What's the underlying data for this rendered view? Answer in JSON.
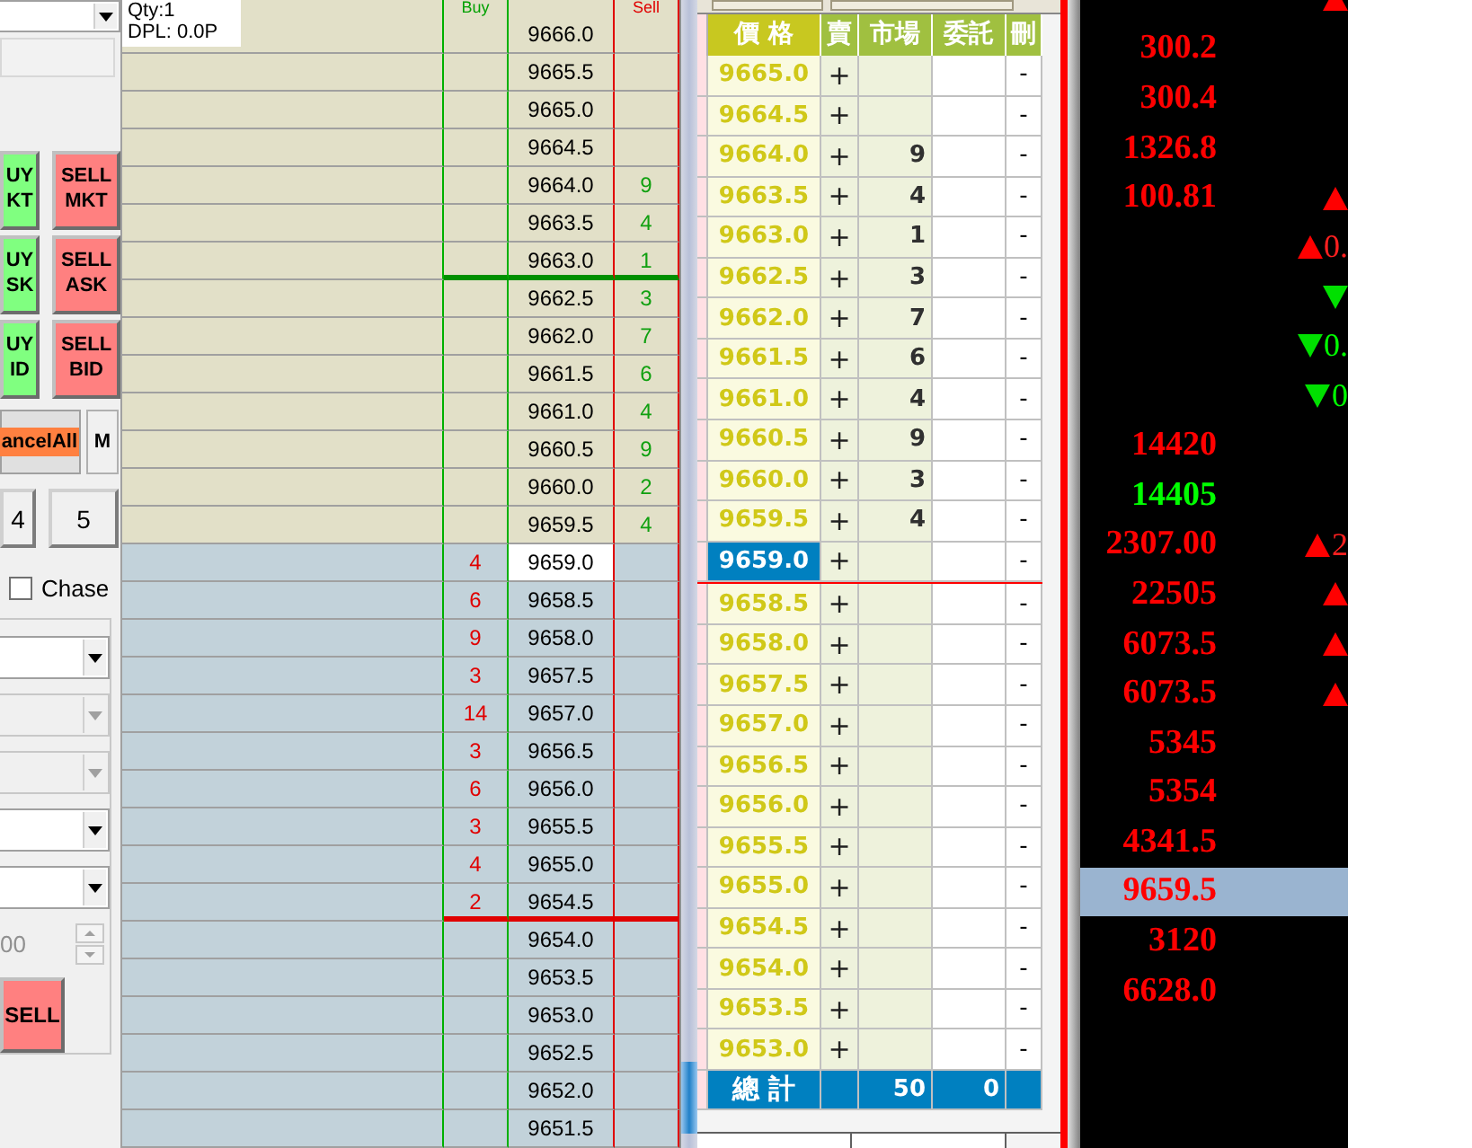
{
  "order_panel": {
    "trade_buttons": [
      {
        "label": "UY\nKT",
        "kind": "buy"
      },
      {
        "label": "SELL\nMKT",
        "kind": "sell"
      },
      {
        "label": "UY\nSK",
        "kind": "buy"
      },
      {
        "label": "SELL\nASK",
        "kind": "sell"
      },
      {
        "label": "UY\nID",
        "kind": "buy"
      },
      {
        "label": "SELL\nBID",
        "kind": "sell"
      }
    ],
    "cancel_all_button": "ancelAll",
    "m_button": "M",
    "number_buttons": [
      "4",
      "5"
    ],
    "chase": {
      "label": "Chase",
      "checked": false
    },
    "dropdowns": [
      {
        "disabled": false
      },
      {
        "disabled": true
      },
      {
        "disabled": true
      },
      {
        "disabled": false
      },
      {
        "disabled": false
      }
    ],
    "spinner": {
      "value": "00",
      "disabled": true
    },
    "sell_button": "SELL"
  },
  "info": {
    "qty": "Qty:1",
    "dpl": "DPL: 0.0P"
  },
  "ladder": {
    "columns": {
      "buy": "Buy",
      "sell": "Sell"
    },
    "rows": [
      {
        "price": "9666.0",
        "kind": "ask",
        "selected": false,
        "line_below": false
      },
      {
        "price": "9665.5",
        "kind": "ask",
        "selected": false,
        "line_below": false
      },
      {
        "price": "9665.0",
        "kind": "ask",
        "selected": false,
        "line_below": false
      },
      {
        "price": "9664.5",
        "kind": "ask",
        "selected": false,
        "line_below": false
      },
      {
        "price": "9664.0",
        "ask": "9",
        "kind": "ask",
        "selected": false,
        "line_below": false
      },
      {
        "price": "9663.5",
        "ask": "4",
        "kind": "ask",
        "selected": false,
        "line_below": false
      },
      {
        "price": "9663.0",
        "ask": "1",
        "kind": "ask",
        "selected": false,
        "line_below": true
      },
      {
        "price": "9662.5",
        "ask": "3",
        "kind": "ask",
        "selected": false,
        "line_below": false
      },
      {
        "price": "9662.0",
        "ask": "7",
        "kind": "ask",
        "selected": false,
        "line_below": false
      },
      {
        "price": "9661.5",
        "ask": "6",
        "kind": "ask",
        "selected": false,
        "line_below": false
      },
      {
        "price": "9661.0",
        "ask": "4",
        "kind": "ask",
        "selected": false,
        "line_below": false
      },
      {
        "price": "9660.5",
        "ask": "9",
        "kind": "ask",
        "selected": false,
        "line_below": false
      },
      {
        "price": "9660.0",
        "ask": "2",
        "kind": "ask",
        "selected": false,
        "line_below": false
      },
      {
        "price": "9659.5",
        "ask": "4",
        "kind": "ask",
        "selected": false,
        "line_below": false
      },
      {
        "price": "9659.0",
        "bid": "4",
        "kind": "bid",
        "selected": true,
        "line_below": false
      },
      {
        "price": "9658.5",
        "bid": "6",
        "kind": "bid",
        "selected": false,
        "line_below": false
      },
      {
        "price": "9658.0",
        "bid": "9",
        "kind": "bid",
        "selected": false,
        "line_below": false
      },
      {
        "price": "9657.5",
        "bid": "3",
        "kind": "bid",
        "selected": false,
        "line_below": false
      },
      {
        "price": "9657.0",
        "bid": "14",
        "kind": "bid",
        "selected": false,
        "line_below": false
      },
      {
        "price": "9656.5",
        "bid": "3",
        "kind": "bid",
        "selected": false,
        "line_below": false
      },
      {
        "price": "9656.0",
        "bid": "6",
        "kind": "bid",
        "selected": false,
        "line_below": false
      },
      {
        "price": "9655.5",
        "bid": "3",
        "kind": "bid",
        "selected": false,
        "line_below": false
      },
      {
        "price": "9655.0",
        "bid": "4",
        "kind": "bid",
        "selected": false,
        "line_below": false
      },
      {
        "price": "9654.5",
        "bid": "2",
        "kind": "bid",
        "selected": false,
        "line_below": true
      },
      {
        "price": "9654.0",
        "kind": "bid",
        "selected": false,
        "line_below": false
      },
      {
        "price": "9653.5",
        "kind": "bid",
        "selected": false,
        "line_below": false
      },
      {
        "price": "9653.0",
        "kind": "bid",
        "selected": false,
        "line_below": false
      },
      {
        "price": "9652.5",
        "kind": "bid",
        "selected": false,
        "line_below": false
      },
      {
        "price": "9652.0",
        "kind": "bid",
        "selected": false,
        "line_below": false
      },
      {
        "price": "9651.5",
        "kind": "bid",
        "selected": false,
        "line_below": false
      }
    ]
  },
  "order_ladder": {
    "columns": [
      "價 格",
      "賣",
      "市場",
      "委託",
      "刪"
    ],
    "rows": [
      {
        "price": "9665.0",
        "sell": "+",
        "delete": "-",
        "selected": false,
        "line_below": false
      },
      {
        "price": "9664.5",
        "sell": "+",
        "delete": "-",
        "selected": false,
        "line_below": false
      },
      {
        "price": "9664.0",
        "sell": "+",
        "market": "9",
        "delete": "-",
        "selected": false,
        "line_below": false
      },
      {
        "price": "9663.5",
        "sell": "+",
        "market": "4",
        "delete": "-",
        "selected": false,
        "line_below": false
      },
      {
        "price": "9663.0",
        "sell": "+",
        "market": "1",
        "delete": "-",
        "selected": false,
        "line_below": false
      },
      {
        "price": "9662.5",
        "sell": "+",
        "market": "3",
        "delete": "-",
        "selected": false,
        "line_below": false
      },
      {
        "price": "9662.0",
        "sell": "+",
        "market": "7",
        "delete": "-",
        "selected": false,
        "line_below": false
      },
      {
        "price": "9661.5",
        "sell": "+",
        "market": "6",
        "delete": "-",
        "selected": false,
        "line_below": false
      },
      {
        "price": "9661.0",
        "sell": "+",
        "market": "4",
        "delete": "-",
        "selected": false,
        "line_below": false
      },
      {
        "price": "9660.5",
        "sell": "+",
        "market": "9",
        "delete": "-",
        "selected": false,
        "line_below": false
      },
      {
        "price": "9660.0",
        "sell": "+",
        "market": "3",
        "delete": "-",
        "selected": false,
        "line_below": false
      },
      {
        "price": "9659.5",
        "sell": "+",
        "market": "4",
        "delete": "-",
        "selected": false,
        "line_below": false
      },
      {
        "price": "9659.0",
        "sell": "+",
        "delete": "-",
        "selected": true,
        "line_below": true
      },
      {
        "price": "9658.5",
        "sell": "+",
        "delete": "-",
        "selected": false,
        "line_below": false
      },
      {
        "price": "9658.0",
        "sell": "+",
        "delete": "-",
        "selected": false,
        "line_below": false
      },
      {
        "price": "9657.5",
        "sell": "+",
        "delete": "-",
        "selected": false,
        "line_below": false
      },
      {
        "price": "9657.0",
        "sell": "+",
        "delete": "-",
        "selected": false,
        "line_below": false
      },
      {
        "price": "9656.5",
        "sell": "+",
        "delete": "-",
        "selected": false,
        "line_below": false
      },
      {
        "price": "9656.0",
        "sell": "+",
        "delete": "-",
        "selected": false,
        "line_below": false
      },
      {
        "price": "9655.5",
        "sell": "+",
        "delete": "-",
        "selected": false,
        "line_below": false
      },
      {
        "price": "9655.0",
        "sell": "+",
        "delete": "-",
        "selected": false,
        "line_below": false
      },
      {
        "price": "9654.5",
        "sell": "+",
        "delete": "-",
        "selected": false,
        "line_below": false
      },
      {
        "price": "9654.0",
        "sell": "+",
        "delete": "-",
        "selected": false,
        "line_below": false
      },
      {
        "price": "9653.5",
        "sell": "+",
        "delete": "-",
        "selected": false,
        "line_below": false
      },
      {
        "price": "9653.0",
        "sell": "+",
        "delete": "-",
        "selected": false,
        "line_below": false
      }
    ],
    "total": {
      "label": "總 計",
      "market": "50",
      "order": "0"
    }
  },
  "quotes": {
    "rows": [
      {
        "kind": "rise",
        "selected": false
      },
      {
        "price": "300.2",
        "color": "#ff0000",
        "kind": "flat",
        "selected": false
      },
      {
        "price": "300.4",
        "color": "#ff0000",
        "kind": "flat",
        "selected": false
      },
      {
        "price": "1326.8",
        "color": "#ff0000",
        "kind": "flat",
        "selected": false
      },
      {
        "price": "100.81",
        "color": "#ff0000",
        "kind": "rise",
        "selected": false
      },
      {
        "kind": "rise",
        "change": "0.",
        "selected": false
      },
      {
        "kind": "fall",
        "selected": false
      },
      {
        "kind": "fall",
        "change": "0.",
        "selected": false
      },
      {
        "kind": "fall",
        "change": "0",
        "selected": false
      },
      {
        "price": "14420",
        "color": "#ff0000",
        "kind": "flat",
        "selected": false
      },
      {
        "price": "14405",
        "color": "#00ff00",
        "kind": "flat",
        "selected": false
      },
      {
        "price": "2307.00",
        "color": "#ff0000",
        "kind": "rise",
        "change": "2",
        "selected": false
      },
      {
        "price": "22505",
        "color": "#ff0000",
        "kind": "rise",
        "selected": false
      },
      {
        "price": "6073.5",
        "color": "#ff0000",
        "kind": "rise",
        "selected": false
      },
      {
        "price": "6073.5",
        "color": "#ff0000",
        "kind": "rise",
        "selected": false
      },
      {
        "price": "5345",
        "color": "#ff0000",
        "kind": "flat",
        "selected": false
      },
      {
        "price": "5354",
        "color": "#ff0000",
        "kind": "flat",
        "selected": false
      },
      {
        "price": "4341.5",
        "color": "#ff0000",
        "kind": "flat",
        "selected": false
      },
      {
        "price": "9659.5",
        "color": "#ff0000",
        "kind": "flat",
        "selected": true
      },
      {
        "price": "3120",
        "color": "#ff0000",
        "kind": "flat",
        "selected": false
      },
      {
        "price": "6628.0",
        "color": "#ff0000",
        "kind": "flat",
        "selected": false
      }
    ]
  }
}
